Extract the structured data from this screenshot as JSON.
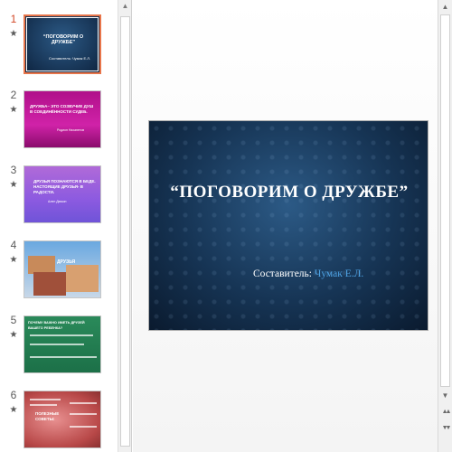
{
  "thumbnails": [
    {
      "number": "1",
      "title": "“ПОГОВОРИМ О ДРУЖБЕ”",
      "line2": "Составитель: Чумак Е.Л."
    },
    {
      "number": "2",
      "title": "ДРУЖБА– ЭТО СОЗВУЧИЕ ДУШ В СОЕДИНЁННОСТИ СУДЕБ.",
      "line2": "Родион Нахапетов"
    },
    {
      "number": "3",
      "title": "ДРУЗЬЯ ПОЗНАЮТСЯ В БЕДЕ. НАСТОЯЩИЕ ДРУЗЬЯ- В РАДОСТИ.",
      "line2": "Ален Дюмон"
    },
    {
      "number": "4",
      "title": "ДРУЗЬЯ"
    },
    {
      "number": "5",
      "title": "ПОЧЕМУ ВАЖНО ИМЕТЬ ДРУЗЕЙ ВАШЕГО РЕБЕНКА?"
    },
    {
      "number": "6",
      "title": "ПОЛЕЗНЫЕ СОВЕТЫ:"
    }
  ],
  "star": "★",
  "main_slide": {
    "title": "“ПОГОВОРИМ О ДРУЖБЕ”",
    "subtitle_label": "Составитель: ",
    "author": "Чумак Е.Л."
  },
  "scroll": {
    "up": "▲",
    "down": "▼",
    "prev_slide": "▲▲",
    "next_slide": "▼▼"
  },
  "colors": {
    "active_thumb_border": "#e8754a",
    "slide_bg": "#163454",
    "author_blue": "#4ea4e6"
  }
}
